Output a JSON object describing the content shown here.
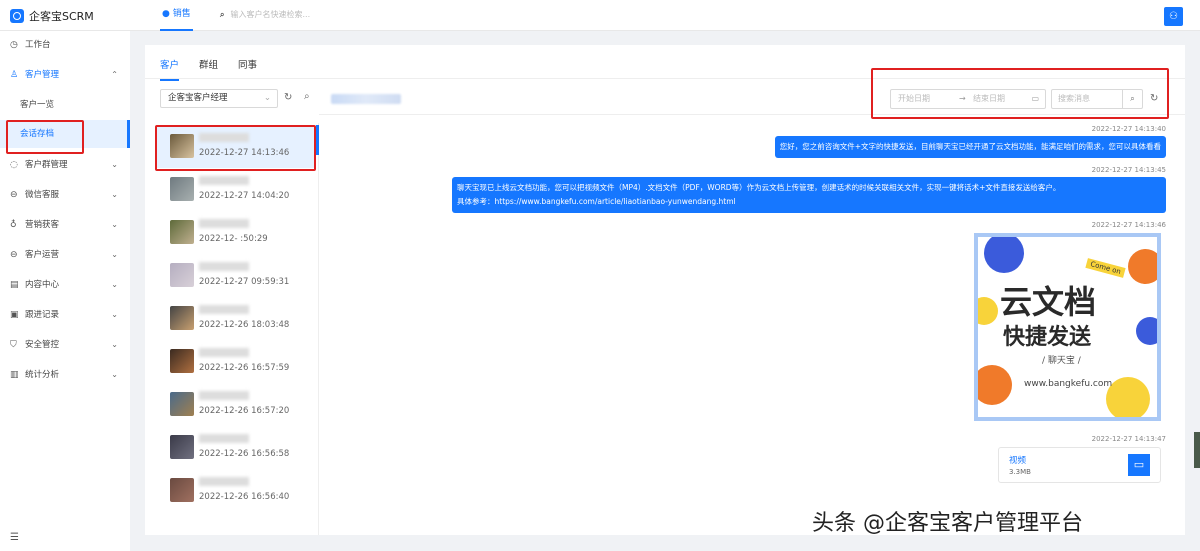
{
  "app": {
    "title": "企客宝SCRM",
    "nav_tab": "销售",
    "search_placeholder": "输入客户名快速检索..."
  },
  "sidebar": {
    "items": [
      {
        "label": "工作台",
        "icon": "dashboard-icon"
      },
      {
        "label": "客户管理",
        "icon": "customer-icon"
      },
      {
        "label": "客户一览"
      },
      {
        "label": "会话存档"
      },
      {
        "label": "客户群管理",
        "icon": "group-icon"
      },
      {
        "label": "微信客服",
        "icon": "wechat-service-icon"
      },
      {
        "label": "营销获客",
        "icon": "location-icon"
      },
      {
        "label": "客户运营",
        "icon": "operation-icon"
      },
      {
        "label": "内容中心",
        "icon": "content-icon"
      },
      {
        "label": "跟进记录",
        "icon": "record-icon"
      },
      {
        "label": "安全管控",
        "icon": "shield-icon"
      },
      {
        "label": "统计分析",
        "icon": "chart-icon"
      }
    ]
  },
  "tabs": [
    "客户",
    "群组",
    "同事"
  ],
  "filter": {
    "staff_select": "企客宝客户经理",
    "start_date": "开始日期",
    "end_date": "结束日期",
    "search_placeholder": "搜索消息"
  },
  "contacts": [
    {
      "time": "2022-12-27 14:13:46"
    },
    {
      "time": "2022-12-27 14:04:20"
    },
    {
      "time": "2022-12-  :50:29"
    },
    {
      "time": "2022-12-27 09:59:31"
    },
    {
      "time": "2022-12-26 18:03:48"
    },
    {
      "time": "2022-12-26 16:57:59"
    },
    {
      "time": "2022-12-26 16:57:20"
    },
    {
      "time": "2022-12-26 16:56:58"
    },
    {
      "time": "2022-12-26 16:56:40"
    }
  ],
  "messages": [
    {
      "time": "2022-12-27 14:13:40",
      "text": "您好，您之前咨询文件+文字的快捷发送，目前聊天宝已经开通了云文档功能，能满足咱们的需求，您可以具体看看"
    },
    {
      "time": "2022-12-27 14:13:45",
      "text": "聊天宝现已上线云文档功能，您可以把视频文件（MP4）.文档文件（PDF，WORD等）作为云文档上传管理，创建话术的时候关联相关文件，实现一键将话术+文件直接发送给客户。",
      "text2": "具体参考：https://www.bangkefu.com/article/liaotianbao-yunwendang.html"
    },
    {
      "time": "2022-12-27 14:13:46",
      "image": {
        "tag": "Come on",
        "line1": "云文档",
        "line2": "快捷发送",
        "brand": "/ 聊天宝 /",
        "url": "www.bangkefu.com"
      }
    },
    {
      "time": "2022-12-27 14:13:47",
      "file": {
        "name": "视频",
        "size": "3.3MB"
      }
    }
  ],
  "watermark": "头条 @企客宝客户管理平台",
  "colors": {
    "accent": "#1677ff",
    "highlight": "#e02020"
  }
}
